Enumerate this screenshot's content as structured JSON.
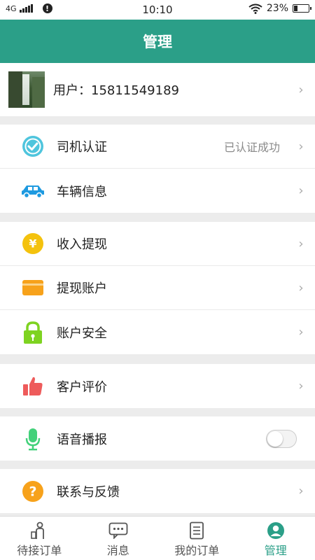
{
  "status_bar": {
    "network": "4G",
    "time": "10:10",
    "battery": "23%"
  },
  "title": "管理",
  "user": {
    "label": "用户：15811549189"
  },
  "groups": [
    {
      "items": [
        {
          "name": "driver-verify",
          "label": "司机认证",
          "status": "已认证成功",
          "icon": "check-shield-icon"
        },
        {
          "name": "vehicle-info",
          "label": "车辆信息",
          "icon": "car-icon"
        }
      ]
    },
    {
      "items": [
        {
          "name": "income-withdraw",
          "label": "收入提现",
          "icon": "yuan-coin-icon"
        },
        {
          "name": "withdraw-account",
          "label": "提现账户",
          "icon": "card-icon"
        },
        {
          "name": "account-security",
          "label": "账户安全",
          "icon": "lock-icon"
        }
      ]
    },
    {
      "items": [
        {
          "name": "customer-review",
          "label": "客户评价",
          "icon": "thumbs-up-icon"
        }
      ]
    },
    {
      "items": [
        {
          "name": "voice-broadcast",
          "label": "语音播报",
          "icon": "microphone-icon",
          "toggle": false
        }
      ]
    },
    {
      "items": [
        {
          "name": "contact-feedback",
          "label": "联系与反馈",
          "icon": "question-icon"
        }
      ]
    }
  ],
  "tabs": [
    {
      "label": "待接订单",
      "icon": "person-waiting-icon",
      "active": false
    },
    {
      "label": "消息",
      "icon": "message-icon",
      "active": false
    },
    {
      "label": "我的订单",
      "icon": "list-icon",
      "active": false
    },
    {
      "label": "管理",
      "icon": "profile-icon",
      "active": true
    }
  ],
  "colors": {
    "accent": "#2b9f88"
  }
}
